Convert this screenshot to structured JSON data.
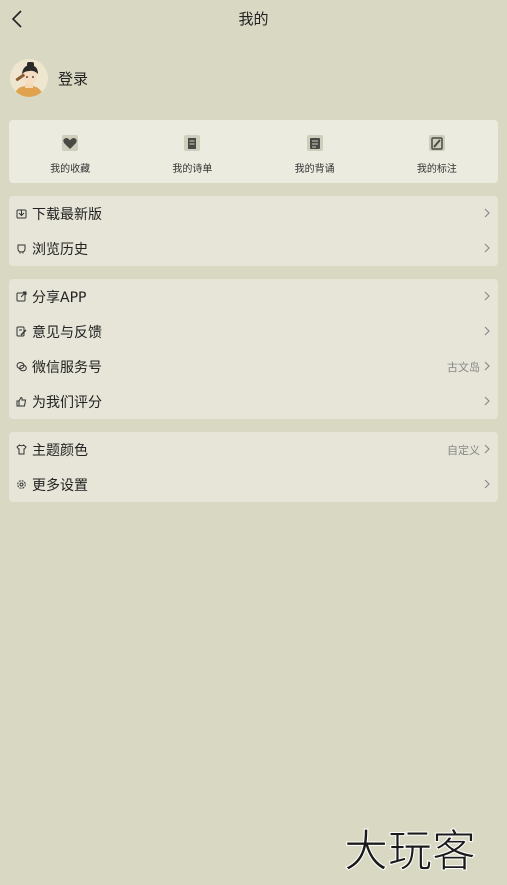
{
  "header": {
    "title": "我的"
  },
  "profile": {
    "login_label": "登录"
  },
  "quick_actions": [
    {
      "label": "我的收藏",
      "icon": "heart-box-icon"
    },
    {
      "label": "我的诗单",
      "icon": "poem-list-icon"
    },
    {
      "label": "我的背诵",
      "icon": "recite-book-icon"
    },
    {
      "label": "我的标注",
      "icon": "annotate-pencil-icon"
    }
  ],
  "group1": [
    {
      "label": "下载最新版",
      "icon": "download-icon"
    },
    {
      "label": "浏览历史",
      "icon": "history-icon"
    }
  ],
  "group2": [
    {
      "label": "分享APP",
      "icon": "share-icon"
    },
    {
      "label": "意见与反馈",
      "icon": "feedback-icon"
    },
    {
      "label": "微信服务号",
      "icon": "wechat-icon",
      "value": "古文岛"
    },
    {
      "label": "为我们评分",
      "icon": "thumbs-up-icon"
    }
  ],
  "group3": [
    {
      "label": "主题颜色",
      "icon": "theme-icon",
      "value": "自定义"
    },
    {
      "label": "更多设置",
      "icon": "settings-icon"
    }
  ],
  "watermark": {
    "text": "大玩客"
  }
}
